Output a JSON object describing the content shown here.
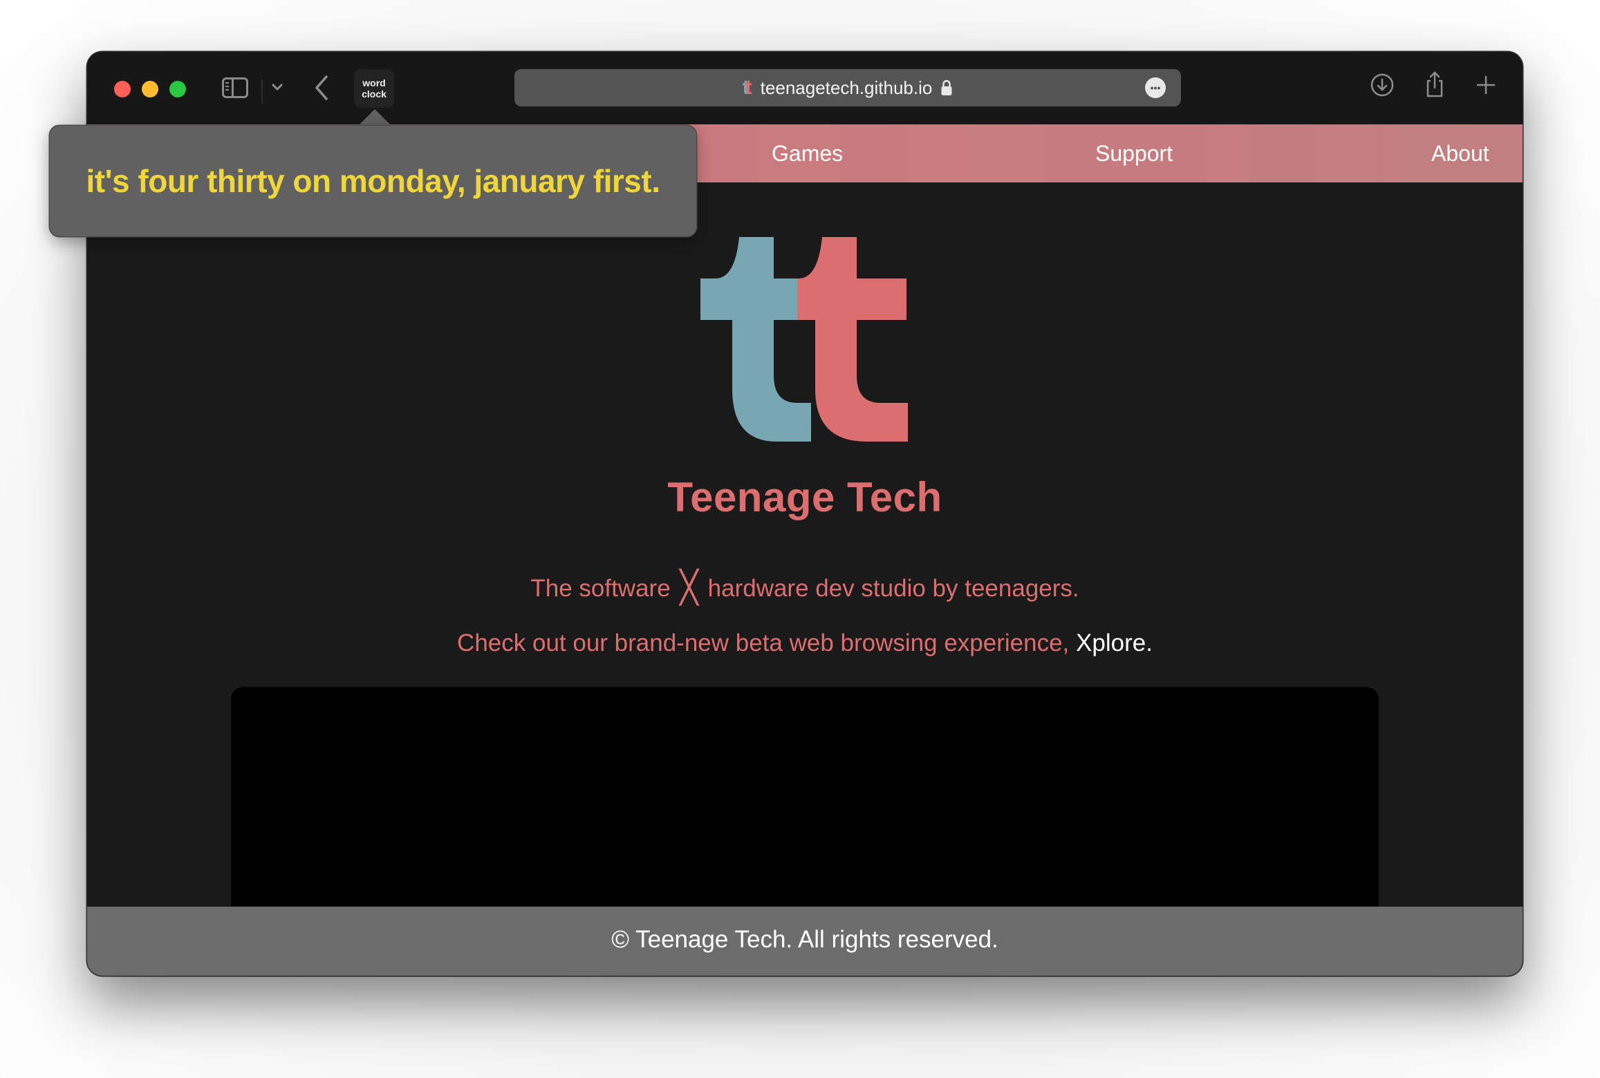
{
  "browser": {
    "url": "teenagetech.github.io",
    "favicon_letters": [
      "t",
      "t"
    ],
    "extension_button": {
      "line1": "word",
      "line2": "clock"
    },
    "icons": {
      "sidebar": "sidebar-icon",
      "tab_overview": "chevron-down-icon",
      "back": "chevron-left-icon",
      "lock": "lock-icon",
      "page_menu": "ellipsis-icon",
      "downloads": "download-icon",
      "share": "share-icon",
      "new_tab": "plus-icon"
    }
  },
  "popover": {
    "text": "it's four thirty on monday, january first."
  },
  "site": {
    "nav": [
      {
        "label": "Games"
      },
      {
        "label": "Support"
      },
      {
        "label": "About"
      }
    ],
    "title": "Teenage Tech",
    "tagline_before": "The software",
    "tagline_cross": "╳",
    "tagline_after": "hardware dev studio by teenagers.",
    "promo_text": "Check out our brand-new beta web browsing experience,",
    "promo_link": "Xplore",
    "promo_end": ".",
    "footer": "© Teenage Tech. All rights reserved."
  },
  "colors": {
    "brand_red": "#dd6e6f",
    "brand_teal": "#78a7b3",
    "nav_bg": "#c97b7e",
    "page_bg": "#1a1a1a",
    "popover_text": "#f1d63b"
  }
}
